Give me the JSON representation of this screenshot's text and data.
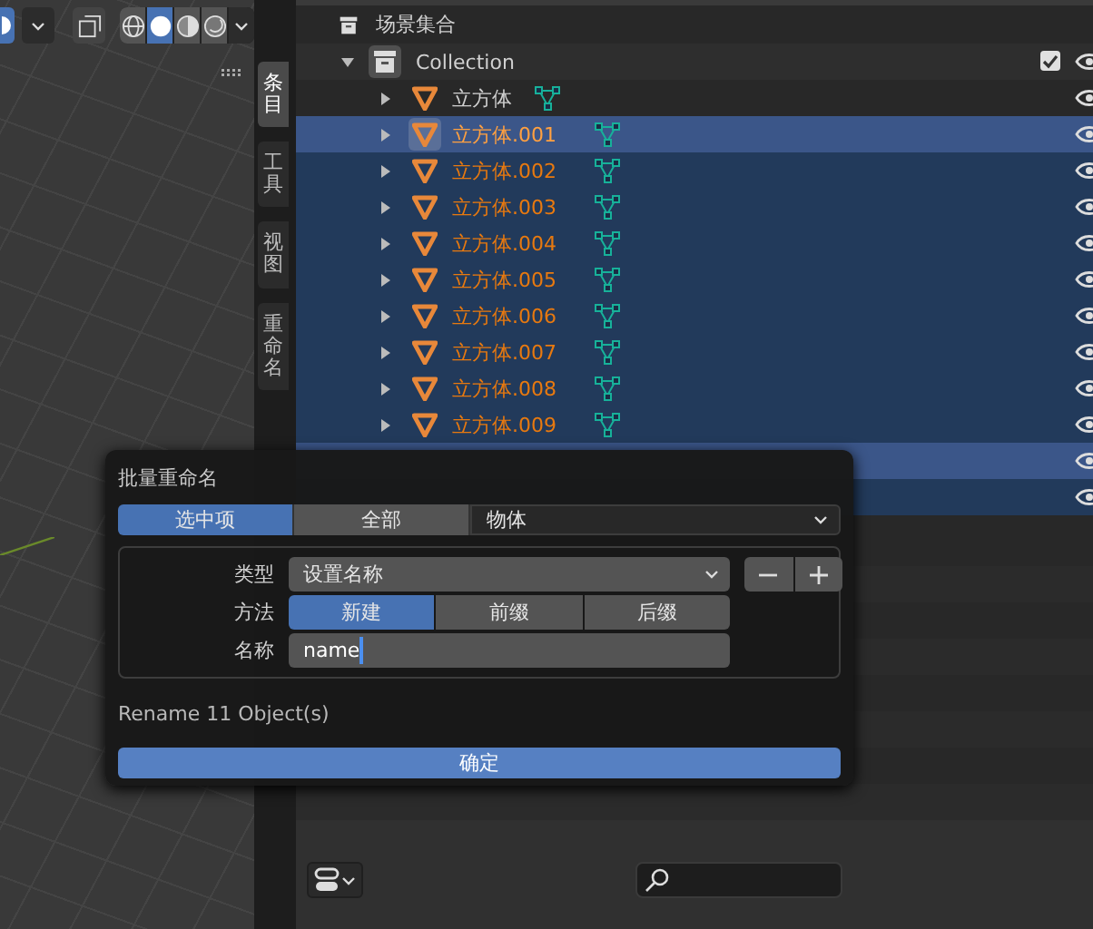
{
  "viewport_header": {
    "shading_modes": [
      {
        "kind": "wireframe",
        "selected": false
      },
      {
        "kind": "solid",
        "selected": true
      },
      {
        "kind": "material",
        "selected": false
      },
      {
        "kind": "rendered",
        "selected": false
      }
    ]
  },
  "sidebar_tabs": [
    {
      "label": "条目",
      "selected": true
    },
    {
      "label": "工具",
      "selected": false
    },
    {
      "label": "视图",
      "selected": false
    },
    {
      "label": "重命名",
      "selected": false
    }
  ],
  "outliner": {
    "scene": "场景集合",
    "collection": {
      "name": "Collection",
      "expanded": true,
      "checked": true
    },
    "rows": [
      {
        "name": "立方体",
        "selected": false,
        "active": false
      },
      {
        "name": "立方体.001",
        "selected": true,
        "active": true
      },
      {
        "name": "立方体.002",
        "selected": true,
        "active": false
      },
      {
        "name": "立方体.003",
        "selected": true,
        "active": false
      },
      {
        "name": "立方体.004",
        "selected": true,
        "active": false
      },
      {
        "name": "立方体.005",
        "selected": true,
        "active": false
      },
      {
        "name": "立方体.006",
        "selected": true,
        "active": false
      },
      {
        "name": "立方体.007",
        "selected": true,
        "active": false
      },
      {
        "name": "立方体.008",
        "selected": true,
        "active": false
      },
      {
        "name": "立方体.009",
        "selected": true,
        "active": false
      },
      {
        "selected": true,
        "active": true
      },
      {
        "selected": true,
        "active": false
      }
    ]
  },
  "dialog": {
    "title": "批量重命名",
    "scopes": [
      {
        "label": "选中项",
        "selected": true
      },
      {
        "label": "全部",
        "selected": false
      }
    ],
    "data_type": "物体",
    "type_label": "类型",
    "type_value": "设置名称",
    "method_label": "方法",
    "methods": [
      {
        "label": "新建",
        "selected": true
      },
      {
        "label": "前缀",
        "selected": false
      },
      {
        "label": "后缀",
        "selected": false
      }
    ],
    "name_label": "名称",
    "name_value": "name",
    "summary": "Rename 11 Object(s)",
    "confirm": "确定"
  }
}
